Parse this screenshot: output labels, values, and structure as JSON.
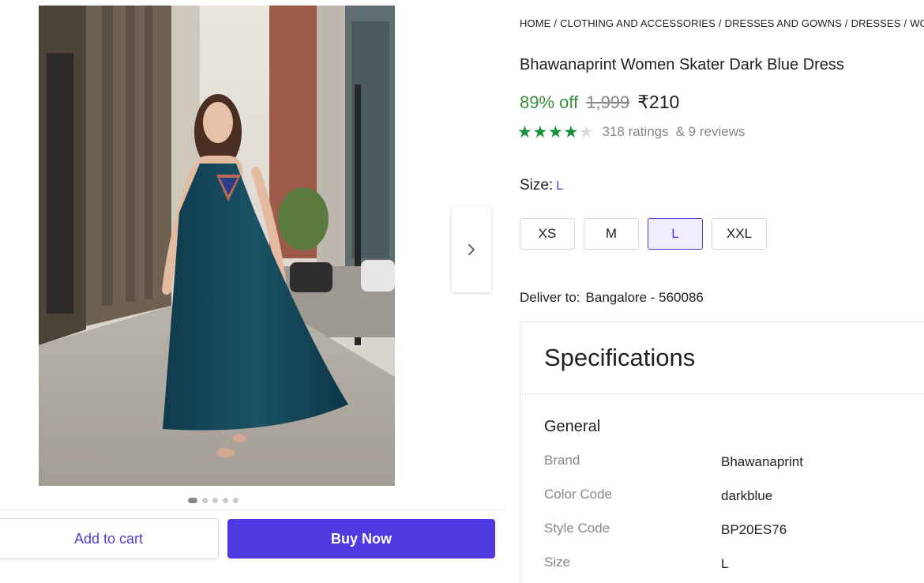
{
  "gallery": {
    "image_alt": "Woman in long dark teal sleeveless dress walking on a city sidewalk",
    "dot_count": 5,
    "active_dot": 0
  },
  "breadcrumb": [
    "HOME",
    "CLOTHING AND ACCESSORIES",
    "DRESSES AND GOWNS",
    "DRESSES",
    "WOMEN"
  ],
  "product": {
    "title": "Bhawanaprint Women Skater Dark Blue Dress",
    "discount": "89% off",
    "mrp": "1,999",
    "price": "₹210",
    "rating_value": 4,
    "ratings": "318 ratings",
    "reviews": "& 9 reviews"
  },
  "size": {
    "label": "Size:",
    "selected": "L",
    "options": [
      "XS",
      "M",
      "L",
      "XXL"
    ]
  },
  "delivery": {
    "label": "Deliver to:",
    "location": "Bangalore - 560086"
  },
  "specifications": {
    "title": "Specifications",
    "group": "General",
    "rows": [
      {
        "key": "Brand",
        "value": "Bhawanaprint"
      },
      {
        "key": "Color Code",
        "value": "darkblue"
      },
      {
        "key": "Style Code",
        "value": "BP20ES76"
      },
      {
        "key": "Size",
        "value": "L"
      }
    ]
  },
  "actions": {
    "add_to_cart": "Add to cart",
    "buy_now": "Buy Now"
  },
  "colors": {
    "accent": "#5039e0",
    "discount_green": "#388e3c",
    "star_green": "#14913b"
  }
}
